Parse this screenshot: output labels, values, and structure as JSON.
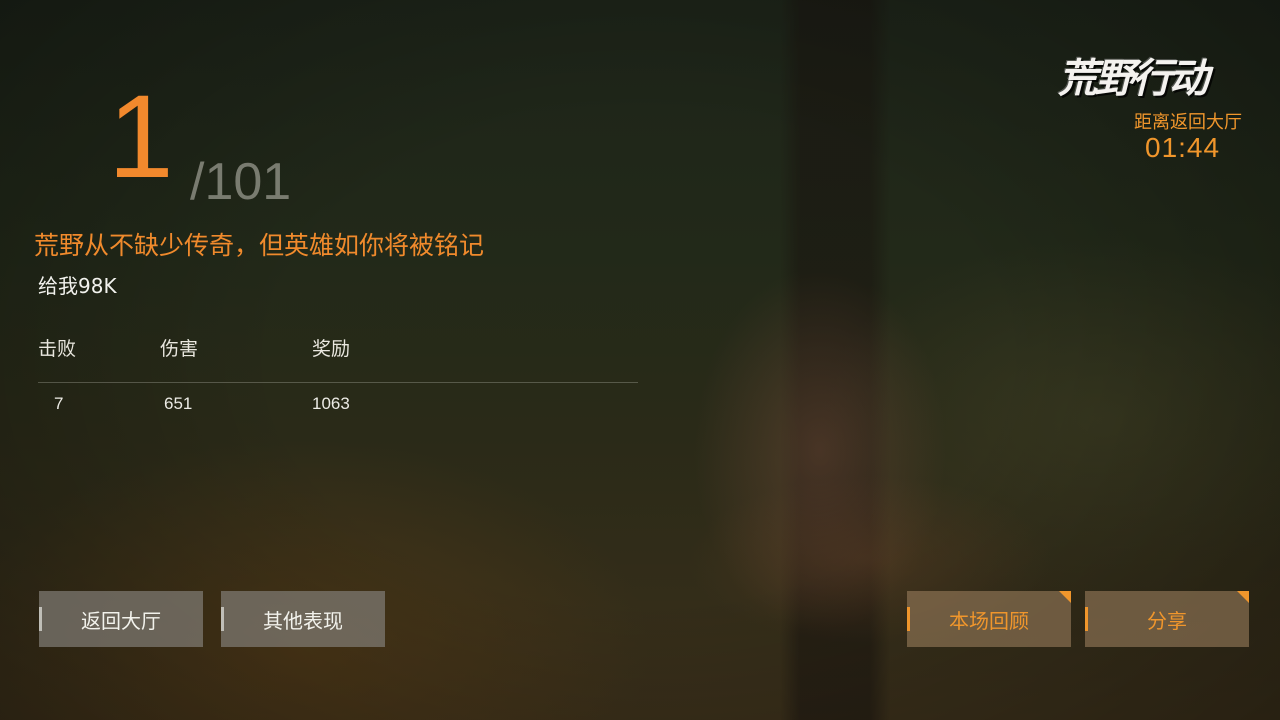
{
  "result": {
    "rank": "1",
    "total": "/101",
    "slogan": "荒野从不缺少传奇，但英雄如你将被铭记",
    "subtitle": "给我98K"
  },
  "stats": {
    "headers": [
      "击败",
      "伤害",
      "奖励"
    ],
    "values": [
      "7",
      "651",
      "1063"
    ]
  },
  "logo": {
    "text": "荒野行动"
  },
  "countdown": {
    "label": "距离返回大厅",
    "time": "01:44"
  },
  "buttons": {
    "return_lobby": "返回大厅",
    "other_performance": "其他表现",
    "match_replay": "本场回顾",
    "share": "分享"
  },
  "colors": {
    "accent": "#f0962c",
    "button_bg": "#807c74"
  }
}
